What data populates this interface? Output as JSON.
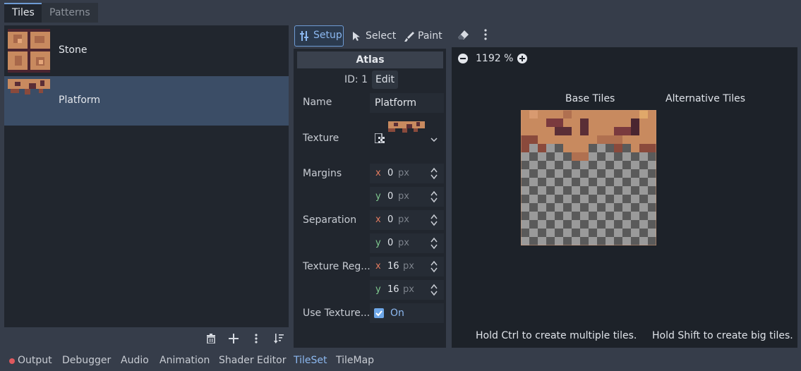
{
  "top_tabs": {
    "tiles": "Tiles",
    "patterns": "Patterns"
  },
  "tiles_list": [
    {
      "label": "Stone",
      "selected": false
    },
    {
      "label": "Platform",
      "selected": true
    }
  ],
  "list_toolbar_icons": [
    "trash-icon",
    "plus-icon",
    "kebab-menu-icon",
    "sort-icon"
  ],
  "editor_toolbar": {
    "setup": "Setup",
    "select": "Select",
    "paint": "Paint",
    "eraser_icon": "eraser-icon",
    "menu_icon": "kebab-menu-icon"
  },
  "inspector": {
    "header": "Atlas",
    "id_label": "ID: 1",
    "edit_label": "Edit",
    "name_label": "Name",
    "name_value": "Platform",
    "texture_label": "Texture",
    "margins_label": "Margins",
    "margins": {
      "x": "0",
      "y": "0"
    },
    "separation_label": "Separation",
    "separation": {
      "x": "0",
      "y": "0"
    },
    "texture_region_label": "Texture Reg...",
    "texture_region": {
      "x": "16",
      "y": "16"
    },
    "unit": "px",
    "use_texture_label": "Use Texture...",
    "use_texture_value": "On",
    "use_texture_checked": true,
    "axis_x": "x",
    "axis_y": "y"
  },
  "atlas_view": {
    "zoom": "1192 %",
    "base_tiles": "Base Tiles",
    "alternative_tiles": "Alternative Tiles",
    "hint_left": "Hold Ctrl to create multiple tiles.",
    "hint_right": "Hold Shift to create big tiles."
  },
  "bottom_tabs": [
    "Output",
    "Debugger",
    "Audio",
    "Animation",
    "Shader Editor",
    "TileSet",
    "TileMap"
  ],
  "bottom_active": "TileSet",
  "colors": {
    "accent": "#6e9bd4",
    "selected_row": "#3b4d66",
    "output_dot": "#e0595e",
    "checkbox": "#6ea7e8"
  }
}
